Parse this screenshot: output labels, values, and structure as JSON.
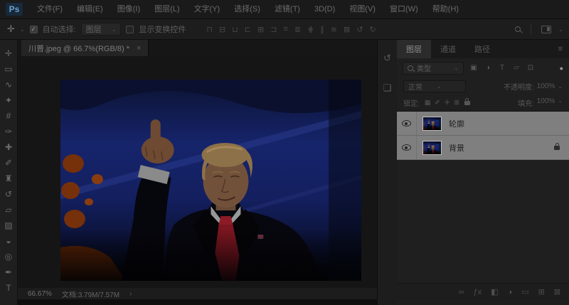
{
  "app": {
    "logo": "Ps"
  },
  "menu_bar": {
    "items": [
      "文件(F)",
      "编辑(E)",
      "图像(I)",
      "图层(L)",
      "文字(Y)",
      "选择(S)",
      "滤镜(T)",
      "3D(D)",
      "视图(V)",
      "窗口(W)",
      "帮助(H)"
    ]
  },
  "options_bar": {
    "tool_icon_glyph": "✛",
    "chevron": "⌄",
    "check_glyph": "✓",
    "auto_select_label": "自动选择:",
    "auto_select_value": "图层",
    "show_transform_label": "显示变换控件",
    "icons": [
      {
        "name": "align-top-edges-icon",
        "glyph": "⊓"
      },
      {
        "name": "align-vertical-centers-icon",
        "glyph": "⊟"
      },
      {
        "name": "align-bottom-edges-icon",
        "glyph": "⊔"
      },
      {
        "name": "align-left-edges-icon",
        "glyph": "⊏"
      },
      {
        "name": "align-horizontal-centers-icon",
        "glyph": "⊞"
      },
      {
        "name": "align-right-edges-icon",
        "glyph": "⊐"
      },
      {
        "name": "distribute-top-edges-icon",
        "glyph": "≡"
      },
      {
        "name": "distribute-vertical-centers-icon",
        "glyph": "≣"
      },
      {
        "name": "distribute-bottom-edges-icon",
        "glyph": "⋕"
      },
      {
        "name": "distribute-left-edges-icon",
        "glyph": "∥"
      },
      {
        "name": "distribute-horizontal-centers-icon",
        "glyph": "≋"
      },
      {
        "name": "distribute-right-edges-icon",
        "glyph": "⊠"
      },
      {
        "name": "rotate-view-ccw-icon",
        "glyph": "↺"
      },
      {
        "name": "rotate-view-cw-icon",
        "glyph": "↻"
      }
    ]
  },
  "toolbar": {
    "tools": [
      {
        "name": "move-tool",
        "glyph": "✛"
      },
      {
        "name": "marquee-tool",
        "glyph": "▭"
      },
      {
        "name": "lasso-tool",
        "glyph": "∿"
      },
      {
        "name": "quick-selection-tool",
        "glyph": "✦"
      },
      {
        "name": "crop-tool",
        "glyph": "#"
      },
      {
        "name": "eyedropper-tool",
        "glyph": "✑"
      },
      {
        "name": "healing-brush-tool",
        "glyph": "✚"
      },
      {
        "name": "brush-tool",
        "glyph": "✐"
      },
      {
        "name": "clone-stamp-tool",
        "glyph": "♜"
      },
      {
        "name": "history-brush-tool",
        "glyph": "↺"
      },
      {
        "name": "eraser-tool",
        "glyph": "▱"
      },
      {
        "name": "gradient-tool",
        "glyph": "▨"
      },
      {
        "name": "blur-tool",
        "glyph": "◒"
      },
      {
        "name": "dodge-tool",
        "glyph": "◎"
      },
      {
        "name": "pen-tool",
        "glyph": "✒"
      },
      {
        "name": "type-tool",
        "glyph": "T"
      }
    ]
  },
  "document_tab": {
    "title": "川普.jpeg @ 66.7%(RGB/8) *",
    "close": "×"
  },
  "status_bar": {
    "zoom": "66.67%",
    "doc_info": "文档:3.79M/7.57M",
    "arrow": "›"
  },
  "dock": {
    "icons": [
      {
        "name": "history-panel-icon",
        "glyph": "↺"
      },
      {
        "name": "properties-panel-icon",
        "glyph": "❏"
      }
    ]
  },
  "panel": {
    "tabs": [
      {
        "label": "图层"
      },
      {
        "label": "通道"
      },
      {
        "label": "路径"
      }
    ],
    "menu_icon": "≡",
    "filter": {
      "type_label": "类型",
      "chevron": "⌄",
      "icons": [
        {
          "name": "filter-pixel-layers-icon",
          "glyph": "▣"
        },
        {
          "name": "filter-adjustment-layers-icon",
          "glyph": "◑"
        },
        {
          "name": "filter-type-layers-icon",
          "glyph": "T"
        },
        {
          "name": "filter-shape-layers-icon",
          "glyph": "▱"
        },
        {
          "name": "filter-smart-objects-icon",
          "glyph": "⊡"
        }
      ],
      "toggle_glyph": "●"
    },
    "blend": {
      "mode": "正常",
      "chevron": "⌄",
      "opacity_label": "不透明度:",
      "opacity_value": "100%"
    },
    "lock": {
      "label": "锁定:",
      "icons": [
        {
          "name": "lock-transparent-pixels-icon",
          "glyph": "▦"
        },
        {
          "name": "lock-image-pixels-icon",
          "glyph": "✐"
        },
        {
          "name": "lock-position-icon",
          "glyph": "✛"
        },
        {
          "name": "lock-artboard-icon",
          "glyph": "⊞"
        }
      ],
      "fill_label": "填充:",
      "fill_value": "100%"
    },
    "layers": [
      {
        "name": "轮廓",
        "locked": false
      },
      {
        "name": "背景",
        "locked": true
      }
    ],
    "footer_icons": [
      {
        "name": "link-layers-icon",
        "glyph": "∞"
      },
      {
        "name": "layer-style-icon",
        "glyph": "ƒx"
      },
      {
        "name": "add-layer-mask-icon",
        "glyph": "◧"
      },
      {
        "name": "new-adjustment-layer-icon",
        "glyph": "◑"
      },
      {
        "name": "new-group-icon",
        "glyph": "▭"
      },
      {
        "name": "new-layer-icon",
        "glyph": "⊞"
      },
      {
        "name": "delete-layer-icon",
        "glyph": "⊠"
      }
    ]
  },
  "colors": {
    "selected_layer_row": "#7f7f7f",
    "photo_background_blue": "#16246b",
    "tie_red": "#7c1620",
    "logo_blue": "#6f9fca"
  }
}
